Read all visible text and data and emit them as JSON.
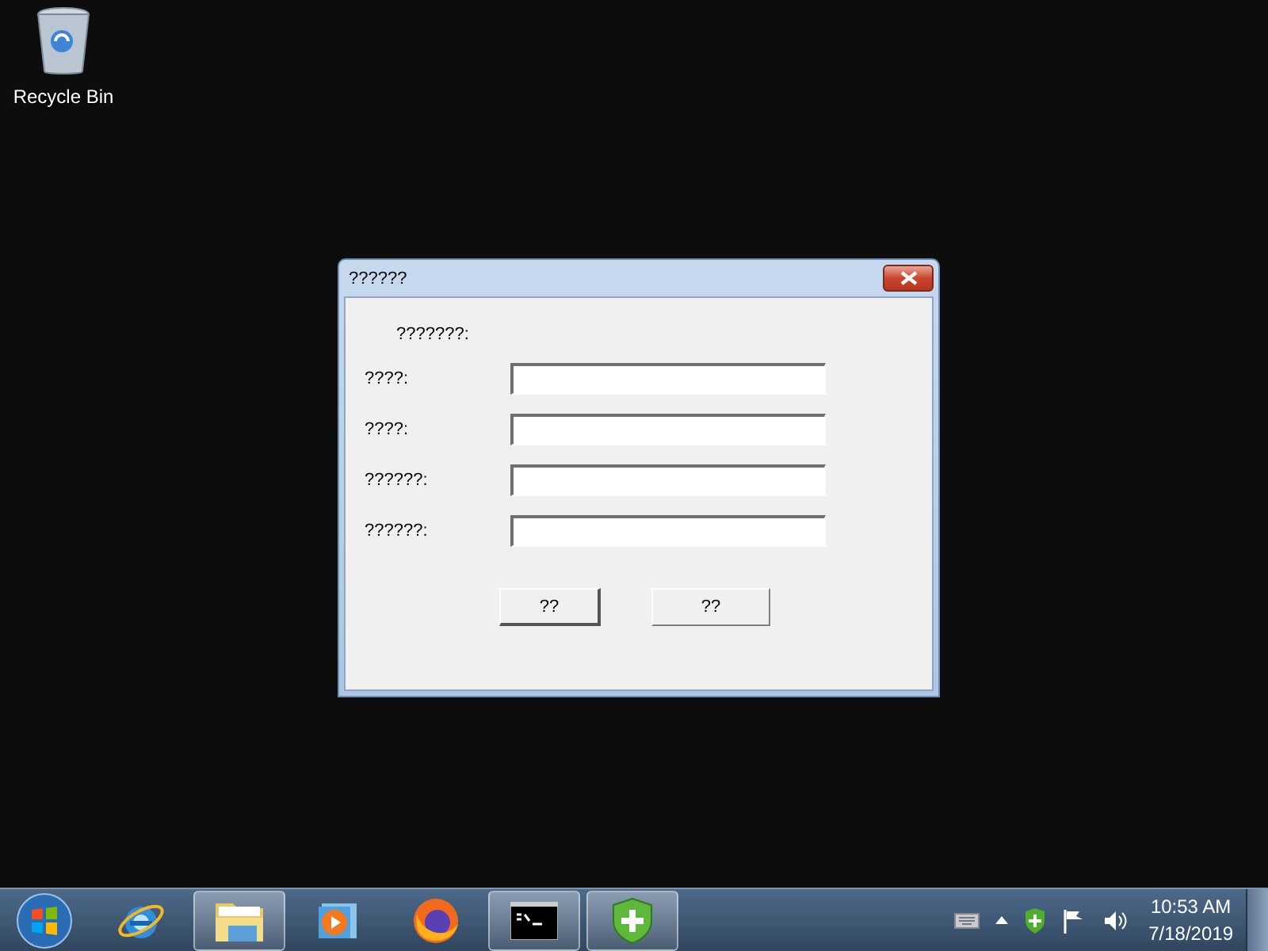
{
  "desktop_icons": [
    {
      "kind": "recycle-bin",
      "label": "Recycle Bin"
    }
  ],
  "dialog": {
    "title": "??????",
    "heading": "???????:",
    "fields": [
      {
        "label": "????:"
      },
      {
        "label": "????:"
      },
      {
        "label": "??????:"
      },
      {
        "label": "??????:"
      }
    ],
    "buttons": [
      {
        "label": "??",
        "default": true
      },
      {
        "label": "??",
        "default": false
      }
    ]
  },
  "taskbar": {
    "items": [
      {
        "kind": "ie",
        "running": false
      },
      {
        "kind": "explorer",
        "running": true
      },
      {
        "kind": "media",
        "running": false
      },
      {
        "kind": "firefox",
        "running": false
      },
      {
        "kind": "cmd",
        "running": true
      },
      {
        "kind": "shield",
        "running": true
      }
    ],
    "tray": [
      {
        "kind": "keyboard"
      },
      {
        "kind": "arrow"
      },
      {
        "kind": "shield"
      },
      {
        "kind": "flag"
      },
      {
        "kind": "speaker"
      }
    ],
    "clock": {
      "time": "10:53 AM",
      "date": "7/18/2019"
    }
  }
}
